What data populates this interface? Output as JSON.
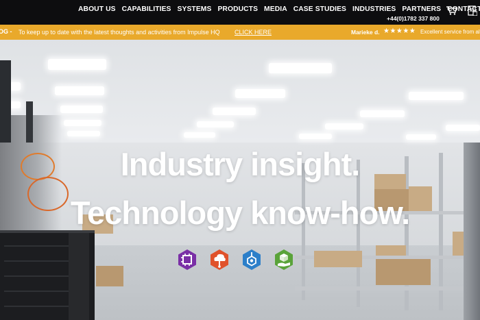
{
  "nav": {
    "items": [
      {
        "label": "ABOUT US"
      },
      {
        "label": "CAPABILITIES"
      },
      {
        "label": "SYSTEMS"
      },
      {
        "label": "PRODUCTS"
      },
      {
        "label": "MEDIA"
      },
      {
        "label": "CASE STUDIES"
      },
      {
        "label": "INDUSTRIES"
      },
      {
        "label": "PARTNERS"
      },
      {
        "label": "CONTACT"
      }
    ],
    "phone": "+44(0)1782 337 800",
    "icons": [
      "cart-icon",
      "document-icon"
    ]
  },
  "banner": {
    "tag": "OG -",
    "text": "To keep up to date with the latest thoughts and activities from Impulse HQ",
    "link": "CLICK HERE",
    "reviewer": "Marieke d.",
    "stars": "★★★★★",
    "review": "Excellent service from all",
    "background_color": "#e9a92b"
  },
  "hero": {
    "title_line1": "Industry insight.",
    "title_line2": "Technology know-how.",
    "badges": [
      {
        "icon": "chip-icon",
        "color": "#7a2fa6"
      },
      {
        "icon": "cloud-icon",
        "color": "#e0522b"
      },
      {
        "icon": "hexagon-node-icon",
        "color": "#2c7fc9"
      },
      {
        "icon": "hand-cube-icon",
        "color": "#5aa33a"
      }
    ]
  },
  "colors": {
    "nav_bg": "#0d0d0f",
    "accent": "#e9a92b"
  }
}
